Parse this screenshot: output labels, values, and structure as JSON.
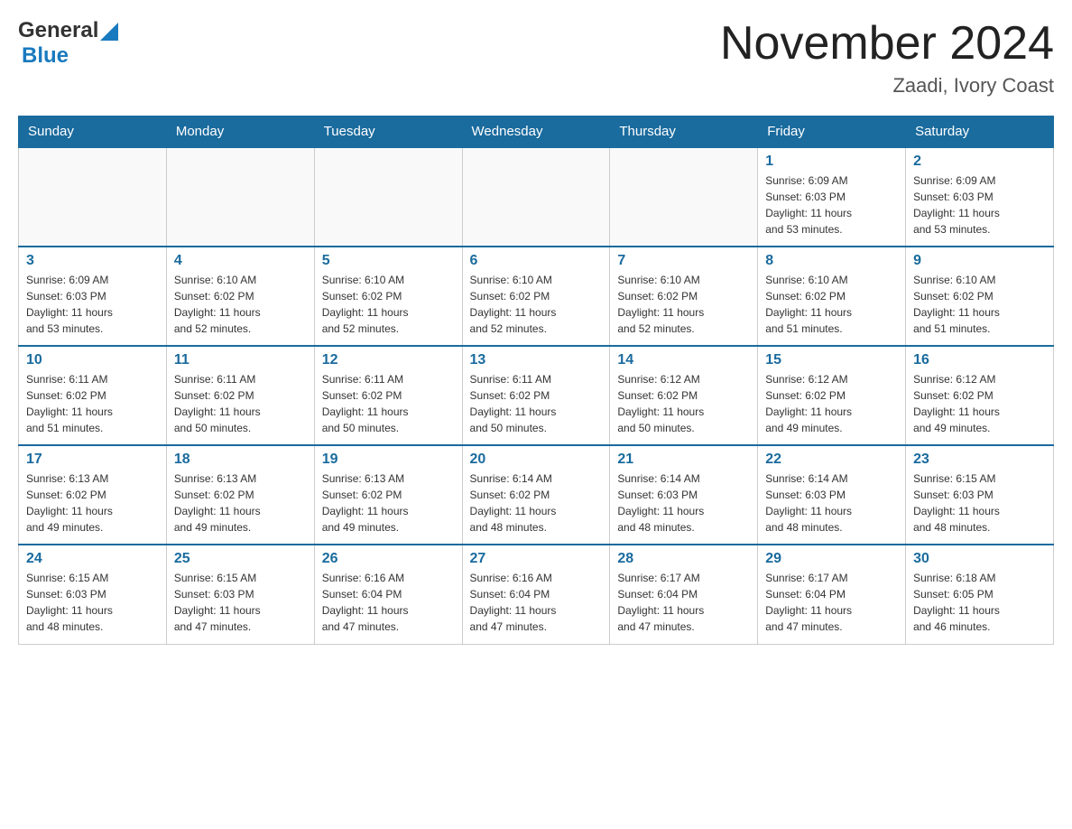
{
  "header": {
    "logo_general": "General",
    "logo_blue": "Blue",
    "month_title": "November 2024",
    "location": "Zaadi, Ivory Coast"
  },
  "days_of_week": [
    "Sunday",
    "Monday",
    "Tuesday",
    "Wednesday",
    "Thursday",
    "Friday",
    "Saturday"
  ],
  "weeks": [
    [
      {
        "day": "",
        "info": ""
      },
      {
        "day": "",
        "info": ""
      },
      {
        "day": "",
        "info": ""
      },
      {
        "day": "",
        "info": ""
      },
      {
        "day": "",
        "info": ""
      },
      {
        "day": "1",
        "info": "Sunrise: 6:09 AM\nSunset: 6:03 PM\nDaylight: 11 hours\nand 53 minutes."
      },
      {
        "day": "2",
        "info": "Sunrise: 6:09 AM\nSunset: 6:03 PM\nDaylight: 11 hours\nand 53 minutes."
      }
    ],
    [
      {
        "day": "3",
        "info": "Sunrise: 6:09 AM\nSunset: 6:03 PM\nDaylight: 11 hours\nand 53 minutes."
      },
      {
        "day": "4",
        "info": "Sunrise: 6:10 AM\nSunset: 6:02 PM\nDaylight: 11 hours\nand 52 minutes."
      },
      {
        "day": "5",
        "info": "Sunrise: 6:10 AM\nSunset: 6:02 PM\nDaylight: 11 hours\nand 52 minutes."
      },
      {
        "day": "6",
        "info": "Sunrise: 6:10 AM\nSunset: 6:02 PM\nDaylight: 11 hours\nand 52 minutes."
      },
      {
        "day": "7",
        "info": "Sunrise: 6:10 AM\nSunset: 6:02 PM\nDaylight: 11 hours\nand 52 minutes."
      },
      {
        "day": "8",
        "info": "Sunrise: 6:10 AM\nSunset: 6:02 PM\nDaylight: 11 hours\nand 51 minutes."
      },
      {
        "day": "9",
        "info": "Sunrise: 6:10 AM\nSunset: 6:02 PM\nDaylight: 11 hours\nand 51 minutes."
      }
    ],
    [
      {
        "day": "10",
        "info": "Sunrise: 6:11 AM\nSunset: 6:02 PM\nDaylight: 11 hours\nand 51 minutes."
      },
      {
        "day": "11",
        "info": "Sunrise: 6:11 AM\nSunset: 6:02 PM\nDaylight: 11 hours\nand 50 minutes."
      },
      {
        "day": "12",
        "info": "Sunrise: 6:11 AM\nSunset: 6:02 PM\nDaylight: 11 hours\nand 50 minutes."
      },
      {
        "day": "13",
        "info": "Sunrise: 6:11 AM\nSunset: 6:02 PM\nDaylight: 11 hours\nand 50 minutes."
      },
      {
        "day": "14",
        "info": "Sunrise: 6:12 AM\nSunset: 6:02 PM\nDaylight: 11 hours\nand 50 minutes."
      },
      {
        "day": "15",
        "info": "Sunrise: 6:12 AM\nSunset: 6:02 PM\nDaylight: 11 hours\nand 49 minutes."
      },
      {
        "day": "16",
        "info": "Sunrise: 6:12 AM\nSunset: 6:02 PM\nDaylight: 11 hours\nand 49 minutes."
      }
    ],
    [
      {
        "day": "17",
        "info": "Sunrise: 6:13 AM\nSunset: 6:02 PM\nDaylight: 11 hours\nand 49 minutes."
      },
      {
        "day": "18",
        "info": "Sunrise: 6:13 AM\nSunset: 6:02 PM\nDaylight: 11 hours\nand 49 minutes."
      },
      {
        "day": "19",
        "info": "Sunrise: 6:13 AM\nSunset: 6:02 PM\nDaylight: 11 hours\nand 49 minutes."
      },
      {
        "day": "20",
        "info": "Sunrise: 6:14 AM\nSunset: 6:02 PM\nDaylight: 11 hours\nand 48 minutes."
      },
      {
        "day": "21",
        "info": "Sunrise: 6:14 AM\nSunset: 6:03 PM\nDaylight: 11 hours\nand 48 minutes."
      },
      {
        "day": "22",
        "info": "Sunrise: 6:14 AM\nSunset: 6:03 PM\nDaylight: 11 hours\nand 48 minutes."
      },
      {
        "day": "23",
        "info": "Sunrise: 6:15 AM\nSunset: 6:03 PM\nDaylight: 11 hours\nand 48 minutes."
      }
    ],
    [
      {
        "day": "24",
        "info": "Sunrise: 6:15 AM\nSunset: 6:03 PM\nDaylight: 11 hours\nand 48 minutes."
      },
      {
        "day": "25",
        "info": "Sunrise: 6:15 AM\nSunset: 6:03 PM\nDaylight: 11 hours\nand 47 minutes."
      },
      {
        "day": "26",
        "info": "Sunrise: 6:16 AM\nSunset: 6:04 PM\nDaylight: 11 hours\nand 47 minutes."
      },
      {
        "day": "27",
        "info": "Sunrise: 6:16 AM\nSunset: 6:04 PM\nDaylight: 11 hours\nand 47 minutes."
      },
      {
        "day": "28",
        "info": "Sunrise: 6:17 AM\nSunset: 6:04 PM\nDaylight: 11 hours\nand 47 minutes."
      },
      {
        "day": "29",
        "info": "Sunrise: 6:17 AM\nSunset: 6:04 PM\nDaylight: 11 hours\nand 47 minutes."
      },
      {
        "day": "30",
        "info": "Sunrise: 6:18 AM\nSunset: 6:05 PM\nDaylight: 11 hours\nand 46 minutes."
      }
    ]
  ]
}
